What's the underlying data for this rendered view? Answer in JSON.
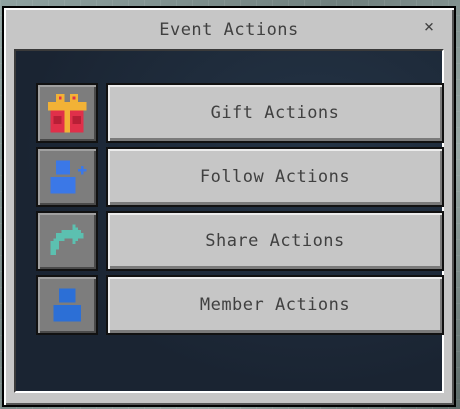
{
  "dialog": {
    "title": "Event Actions",
    "close_label": "×"
  },
  "actions": [
    {
      "label": "Gift Actions",
      "icon": "gift-icon"
    },
    {
      "label": "Follow Actions",
      "icon": "follow-user-icon"
    },
    {
      "label": "Share Actions",
      "icon": "share-arrow-icon"
    },
    {
      "label": "Member Actions",
      "icon": "member-user-icon"
    }
  ],
  "colors": {
    "panel": "#c6c6c6",
    "content_bg": "#1e2a38",
    "icon_slot": "#7d7d7d",
    "gift_red": "#e0304a",
    "gift_gold": "#f2b236",
    "follow_blue": "#3b78e7",
    "share_teal": "#5cc0b0",
    "member_blue": "#2c6fd6"
  }
}
